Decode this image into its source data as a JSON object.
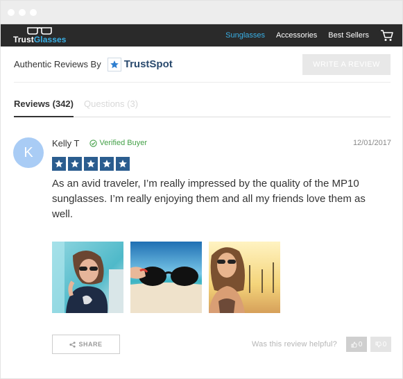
{
  "nav": {
    "logo_trust": "Trust",
    "logo_glasses": "Glasses",
    "items": [
      {
        "label": "Sunglasses",
        "active": true
      },
      {
        "label": "Accessories",
        "active": false
      },
      {
        "label": "Best Sellers",
        "active": false
      }
    ],
    "cart_icon": "cart-icon"
  },
  "header": {
    "authentic_label": "Authentic Reviews By",
    "trustspot_label": "TrustSpot",
    "write_review_label": "WRITE A REVIEW"
  },
  "tabs": [
    {
      "label": "Reviews (342)",
      "active": true
    },
    {
      "label": "Questions (3)",
      "active": false
    }
  ],
  "review": {
    "avatar_initial": "K",
    "author": "Kelly T",
    "verified_label": "Verified Buyer",
    "date": "12/01/2017",
    "rating": 5,
    "text": "As an avid traveler, I’m really impressed by the quality of the MP10 sunglasses. I’m really enjoying them and all my friends love them as well.",
    "photos": [
      "photo-woman-sunglasses-beach",
      "photo-hand-holding-sunglasses",
      "photo-woman-sunset"
    ]
  },
  "footer": {
    "share_label": "SHARE",
    "helpful_question": "Was this review helpful?",
    "upvotes": "0",
    "downvotes": "0"
  },
  "colors": {
    "accent": "#39b0e6",
    "nav_bg": "#2a2a2a",
    "star_bg": "#2b5d8f",
    "verified": "#43a047",
    "avatar": "#a9ccf5"
  }
}
